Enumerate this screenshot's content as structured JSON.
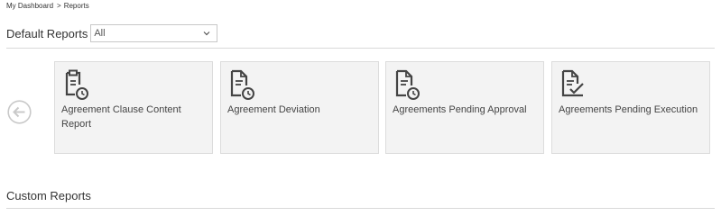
{
  "breadcrumb": {
    "items": [
      "My Dashboard",
      "Reports"
    ],
    "separator": ">"
  },
  "default_reports": {
    "title": "Default Reports",
    "filter": {
      "selected": "All",
      "icon": "chevron-down-icon"
    }
  },
  "carousel": {
    "prev_icon": "arrow-left-circle-icon",
    "tiles": [
      {
        "label": "Agreement Clause Content Report",
        "icon": "clipboard-clock-icon"
      },
      {
        "label": "Agreement Deviation",
        "icon": "document-clock-icon"
      },
      {
        "label": "Agreements Pending Approval",
        "icon": "document-clock-icon"
      },
      {
        "label": "Agreements Pending Execution",
        "icon": "document-check-icon"
      }
    ]
  },
  "custom_reports": {
    "title": "Custom Reports"
  },
  "colors": {
    "tile_background": "#f3f3f3",
    "tile_border": "#dcdcdc",
    "icon": "#444444",
    "divider": "#d9d9d9"
  }
}
